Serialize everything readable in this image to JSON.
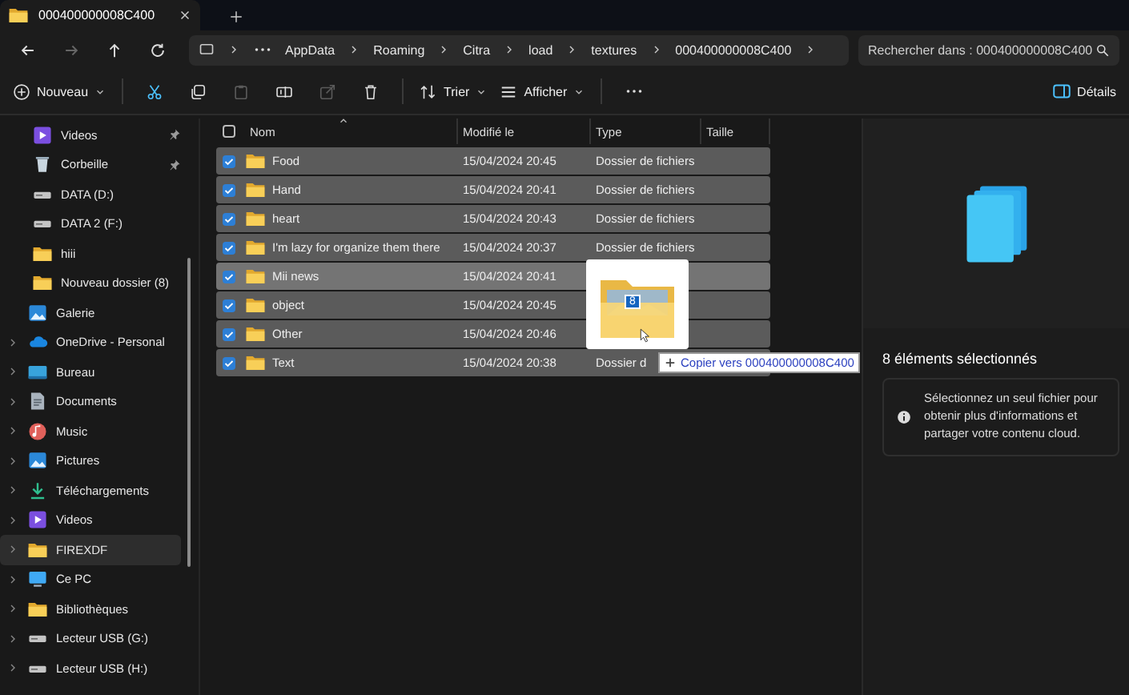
{
  "tab": {
    "title": "000400000008C400",
    "selected": true
  },
  "nav": {
    "back_disabled": false,
    "forward_disabled": true
  },
  "address": {
    "crumbs": [
      "AppData",
      "Roaming",
      "Citra",
      "load",
      "textures",
      "000400000008C400"
    ]
  },
  "search": {
    "placeholder": "Rechercher dans : 000400000008C400"
  },
  "toolbar": {
    "new_label": "Nouveau",
    "actions": [
      {
        "kind": "cut",
        "disabled": false
      },
      {
        "kind": "copy",
        "disabled": false
      },
      {
        "kind": "paste",
        "disabled": true
      },
      {
        "kind": "rename",
        "disabled": false
      },
      {
        "kind": "share",
        "disabled": true
      },
      {
        "kind": "delete",
        "disabled": false
      }
    ],
    "sort_label": "Trier",
    "view_label": "Afficher",
    "details_label": "Détails"
  },
  "sidebar": {
    "quick_access": [
      {
        "label": "Videos",
        "kind": "video",
        "pinned": true,
        "selected": false
      },
      {
        "label": "Corbeille",
        "kind": "recycle",
        "pinned": true,
        "selected": false
      },
      {
        "label": "DATA (D:)",
        "kind": "drive",
        "pinned": false,
        "selected": false
      },
      {
        "label": "DATA 2 (F:)",
        "kind": "drive",
        "pinned": false,
        "selected": false
      },
      {
        "label": "hiii",
        "kind": "folder",
        "pinned": false,
        "selected": false
      },
      {
        "label": "Nouveau dossier (8)",
        "kind": "folder",
        "pinned": false,
        "selected": false
      }
    ],
    "items": [
      {
        "label": "Galerie",
        "kind": "gallery",
        "expandable": false,
        "selected": false
      },
      {
        "label": "OneDrive - Personal",
        "kind": "cloud",
        "expandable": true,
        "selected": false
      },
      {
        "label": "Bureau",
        "kind": "desktop",
        "expandable": true,
        "selected": false
      },
      {
        "label": "Documents",
        "kind": "documents",
        "expandable": true,
        "selected": false
      },
      {
        "label": "Music",
        "kind": "music",
        "expandable": true,
        "selected": false
      },
      {
        "label": "Pictures",
        "kind": "pictures",
        "expandable": true,
        "selected": false
      },
      {
        "label": "Téléchargements",
        "kind": "download",
        "expandable": true,
        "selected": false
      },
      {
        "label": "Videos",
        "kind": "video",
        "expandable": true,
        "selected": false
      },
      {
        "label": "FIREXDF",
        "kind": "folder",
        "expandable": true,
        "selected": true
      },
      {
        "label": "Ce PC",
        "kind": "pc",
        "expandable": true,
        "selected": false
      },
      {
        "label": "Bibliothèques",
        "kind": "folder",
        "expandable": true,
        "selected": false
      },
      {
        "label": "Lecteur USB (G:)",
        "kind": "drive",
        "expandable": true,
        "selected": false
      },
      {
        "label": "Lecteur USB (H:)",
        "kind": "drive",
        "expandable": true,
        "selected": false
      }
    ]
  },
  "list": {
    "select_all": {
      "checked": false
    },
    "columns": [
      {
        "label": "Nom",
        "sorted": true
      },
      {
        "label": "Modifié le",
        "sorted": false
      },
      {
        "label": "Type",
        "sorted": false
      },
      {
        "label": "Taille",
        "sorted": false
      }
    ],
    "rows": [
      {
        "name": "Food",
        "modified": "15/04/2024 20:45",
        "type": "Dossier de fichiers",
        "selected": true,
        "hovered": false
      },
      {
        "name": "Hand",
        "modified": "15/04/2024 20:41",
        "type": "Dossier de fichiers",
        "selected": true,
        "hovered": false
      },
      {
        "name": "heart",
        "modified": "15/04/2024 20:43",
        "type": "Dossier de fichiers",
        "selected": true,
        "hovered": false
      },
      {
        "name": "I'm lazy for organize them there",
        "modified": "15/04/2024 20:37",
        "type": "Dossier de fichiers",
        "selected": true,
        "hovered": false
      },
      {
        "name": "Mii news",
        "modified": "15/04/2024 20:41",
        "selected": true,
        "hovered": true
      },
      {
        "name": "object",
        "modified": "15/04/2024 20:45",
        "selected": true,
        "hovered": false
      },
      {
        "name": "Other",
        "modified": "15/04/2024 20:46",
        "selected": true,
        "hovered": false
      },
      {
        "name": "Text",
        "modified": "15/04/2024 20:38",
        "type": "Dossier d",
        "selected": true,
        "hovered": false
      }
    ]
  },
  "drag": {
    "count": "8",
    "tooltip": "Copier vers 000400000008C400"
  },
  "details": {
    "title": "8 éléments sélectionnés",
    "info": "Sélectionnez un seul fichier pour obtenir plus d'informations et partager votre contenu cloud."
  }
}
